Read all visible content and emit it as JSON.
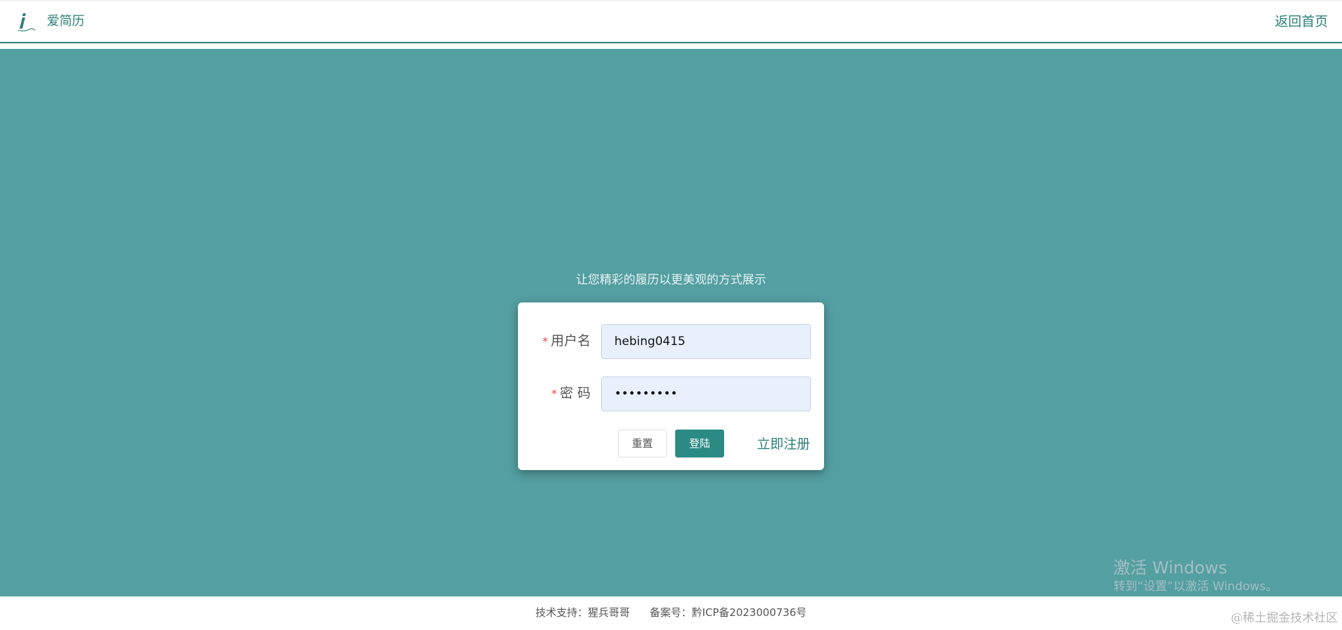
{
  "header": {
    "logo_text": "爱简历",
    "home_link": "返回首页"
  },
  "colors": {
    "brand": "#2c7f79",
    "background": "#549fa2",
    "login_button": "#2c8a84",
    "required_mark": "#e04545"
  },
  "login": {
    "slogan": "让您精彩的履历以更美观的方式展示",
    "required_mark": "*",
    "username_label": "用户名",
    "username_value": "hebing0415",
    "password_label": "密 码",
    "password_value": "•••••••••",
    "reset_label": "重置",
    "login_label": "登陆",
    "register_link": "立即注册"
  },
  "watermark": {
    "title": "激活 Windows",
    "subtitle": "转到“设置”以激活 Windows。"
  },
  "footer": {
    "text": "技术支持：猩兵哥哥      备案号：黔ICP备2023000736号",
    "juejin": "@稀土掘金技术社区"
  },
  "icons": {
    "logo": "italic-i-pen-logo-icon"
  }
}
